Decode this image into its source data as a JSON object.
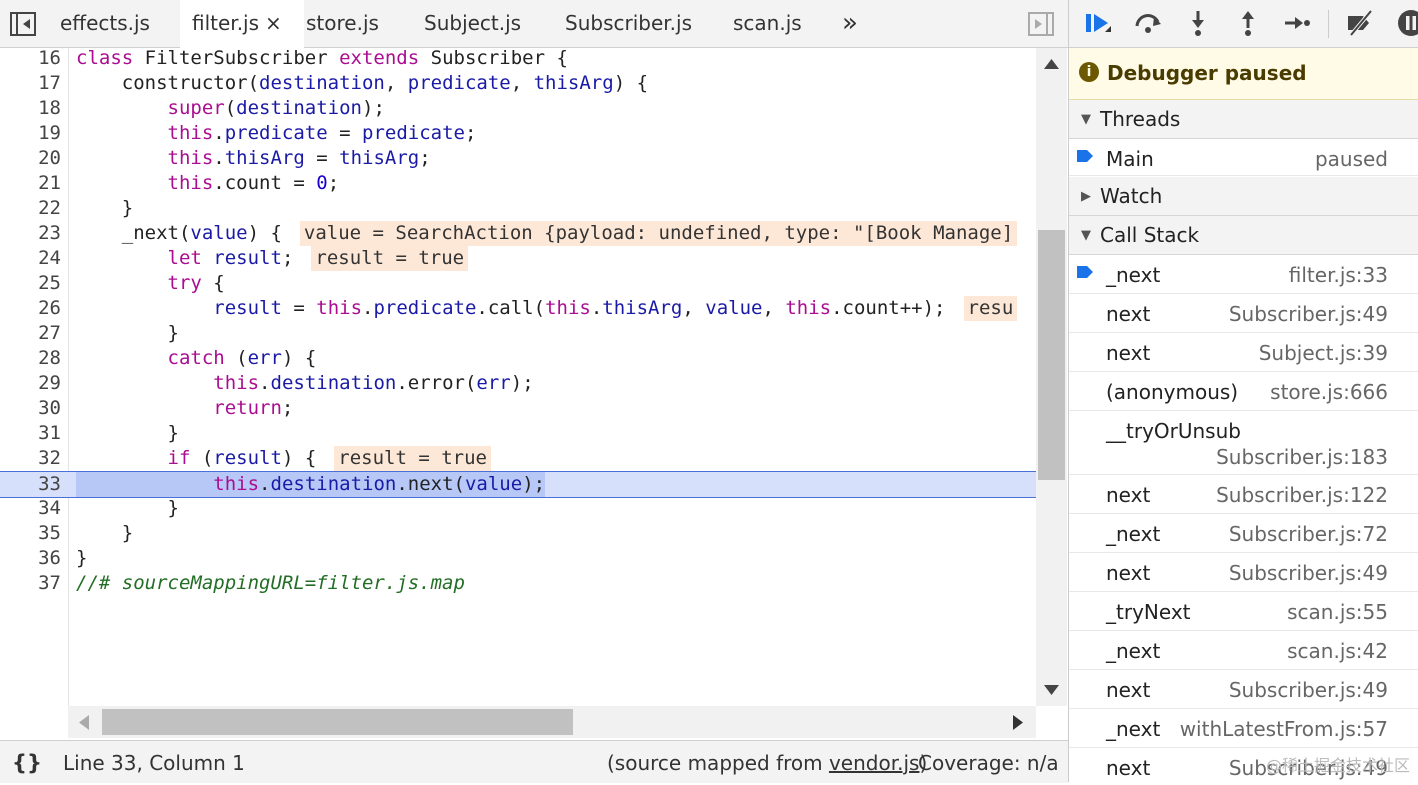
{
  "tabs": {
    "items": [
      {
        "label": "effects.js"
      },
      {
        "label": "filter.js",
        "active": true,
        "close": "×"
      },
      {
        "label": "store.js"
      },
      {
        "label": "Subject.js"
      },
      {
        "label": "Subscriber.js"
      },
      {
        "label": "scan.js"
      }
    ],
    "overflow": "»"
  },
  "code": {
    "lines": [
      {
        "n": "16",
        "text": "class FilterSubscriber extends Subscriber {"
      },
      {
        "n": "17",
        "text": "    constructor(destination, predicate, thisArg) {"
      },
      {
        "n": "18",
        "text": "        super(destination);"
      },
      {
        "n": "19",
        "text": "        this.predicate = predicate;"
      },
      {
        "n": "20",
        "text": "        this.thisArg = thisArg;"
      },
      {
        "n": "21",
        "text": "        this.count = 0;"
      },
      {
        "n": "22",
        "text": "    }"
      },
      {
        "n": "23",
        "text": "    _next(value) {",
        "inline": "value = SearchAction {payload: undefined, type: \"[Book Manage]"
      },
      {
        "n": "24",
        "text": "        let result;",
        "inline": "result = true"
      },
      {
        "n": "25",
        "text": "        try {"
      },
      {
        "n": "26",
        "text": "            result = this.predicate.call(this.thisArg, value, this.count++);",
        "inline": "resu"
      },
      {
        "n": "27",
        "text": "        }"
      },
      {
        "n": "28",
        "text": "        catch (err) {"
      },
      {
        "n": "29",
        "text": "            this.destination.error(err);"
      },
      {
        "n": "30",
        "text": "            return;"
      },
      {
        "n": "31",
        "text": "        }"
      },
      {
        "n": "32",
        "text": "        if (result) {",
        "inline": "result = true"
      },
      {
        "n": "33",
        "text": "            this.destination.next(value);",
        "current": true
      },
      {
        "n": "34",
        "text": "        }"
      },
      {
        "n": "35",
        "text": "    }"
      },
      {
        "n": "36",
        "text": "}"
      },
      {
        "n": "37",
        "text": "//# sourceMappingURL=filter.js.map",
        "comment": true
      }
    ]
  },
  "status": {
    "braces": "{}",
    "position": "Line 33, Column 1",
    "source_prefix": "(source mapped from ",
    "source_link": "vendor.js",
    "source_suffix": ")",
    "coverage": "Coverage: n/a"
  },
  "debugger": {
    "paused_label": "Debugger paused",
    "threads": {
      "title": "Threads",
      "items": [
        {
          "name": "Main",
          "state": "paused"
        }
      ]
    },
    "watch": {
      "title": "Watch"
    },
    "call_stack": {
      "title": "Call Stack",
      "frames": [
        {
          "fn": "_next",
          "loc": "filter.js:33",
          "current": true
        },
        {
          "fn": "next",
          "loc": "Subscriber.js:49"
        },
        {
          "fn": "next",
          "loc": "Subject.js:39"
        },
        {
          "fn": "(anonymous)",
          "loc": "store.js:666"
        },
        {
          "fn": "__tryOrUnsub",
          "loc": "Subscriber.js:183",
          "wrap": true
        },
        {
          "fn": "next",
          "loc": "Subscriber.js:122"
        },
        {
          "fn": "_next",
          "loc": "Subscriber.js:72"
        },
        {
          "fn": "next",
          "loc": "Subscriber.js:49"
        },
        {
          "fn": "_tryNext",
          "loc": "scan.js:55"
        },
        {
          "fn": "_next",
          "loc": "scan.js:42"
        },
        {
          "fn": "next",
          "loc": "Subscriber.js:49"
        },
        {
          "fn": "_next",
          "loc": "withLatestFrom.js:57"
        },
        {
          "fn": "next",
          "loc": "Subscriber.js:49"
        }
      ]
    }
  },
  "watermark": "@稀土掘金技术社区",
  "colors": {
    "accent": "#1a73e8",
    "keyword": "#aa0d91",
    "identifier": "#1c00cf",
    "comment": "#236e25",
    "inline_value_bg": "#fde8d8",
    "current_line_bg": "#d6e0fb",
    "paused_bg": "#fffbe6"
  }
}
